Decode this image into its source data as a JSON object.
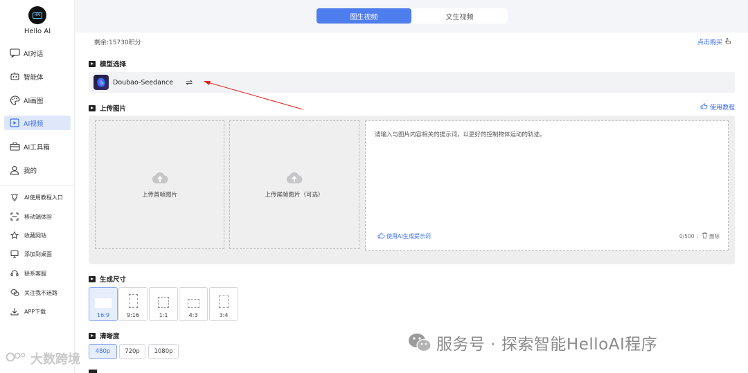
{
  "sidebar": {
    "brand": "Hello AI",
    "logo_text": "HAI",
    "items": [
      {
        "label": "AI对话",
        "icon": "chat-icon"
      },
      {
        "label": "智能体",
        "icon": "robot-icon"
      },
      {
        "label": "AI画图",
        "icon": "palette-icon"
      },
      {
        "label": "AI视频",
        "icon": "video-icon",
        "active": true
      },
      {
        "label": "AI工具箱",
        "icon": "toolbox-icon"
      },
      {
        "label": "我的",
        "icon": "user-icon"
      }
    ],
    "sub_items": [
      {
        "label": "AI使用教程入口",
        "icon": "bulb-icon"
      },
      {
        "label": "移动端体验",
        "icon": "scan-icon"
      },
      {
        "label": "收藏网站",
        "icon": "star-icon"
      },
      {
        "label": "添加到桌面",
        "icon": "monitor-icon"
      },
      {
        "label": "联系客服",
        "icon": "headset-icon"
      },
      {
        "label": "关注我不迷路",
        "icon": "wechat-icon"
      },
      {
        "label": "APP下载",
        "icon": "download-icon"
      }
    ]
  },
  "tabs": [
    {
      "label": "图生视频",
      "active": true
    },
    {
      "label": "文生视频",
      "active": false
    }
  ],
  "balance": "剩余:15730积分",
  "buy_link": "点击购买",
  "model_section": {
    "title": "模型选择",
    "model_name": "Doubao-Seedance",
    "swap_symbol": "⇌"
  },
  "upload_section": {
    "title": "上传图片",
    "tutorial_link": "使用教程",
    "first_frame": "上传首帧图片",
    "last_frame": "上传尾帧图片（可选）",
    "prompt_placeholder": "请输入与图片内容相关的提示词，以更好的控制物体运动的轨迹。",
    "ai_prompt": "使用AI生成提示词",
    "counter": "0/500",
    "delete": "删除"
  },
  "size_section": {
    "title": "生成尺寸",
    "options": [
      {
        "label": "16:9",
        "active": true
      },
      {
        "label": "9:16",
        "active": false
      },
      {
        "label": "1:1",
        "active": false
      },
      {
        "label": "4:3",
        "active": false
      },
      {
        "label": "3:4",
        "active": false
      }
    ]
  },
  "resolution_section": {
    "title": "清晰度",
    "options": [
      {
        "label": "480p",
        "active": true
      },
      {
        "label": "720p",
        "active": false
      },
      {
        "label": "1080p",
        "active": false
      }
    ]
  },
  "watermark": "服务号 · 探索智能HelloAI程序",
  "watermark2": "大数跨境",
  "colors": {
    "accent": "#4e7dee",
    "link": "#3c6ef0",
    "active_bg": "#dfe8fb",
    "annotation_arrow": "#e02020"
  }
}
